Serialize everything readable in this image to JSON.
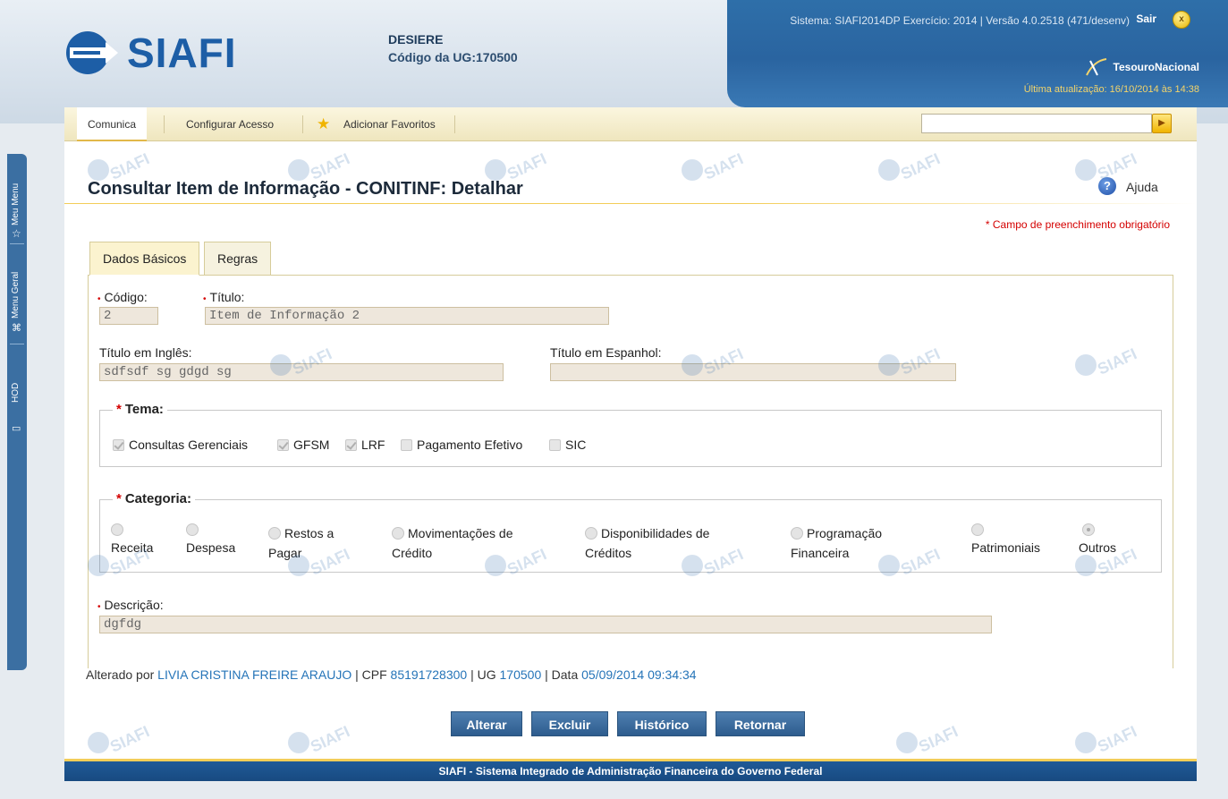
{
  "header": {
    "logo_text": "SIAFI",
    "user_name": "DESIERE",
    "ug_label": "Código da UG:",
    "ug_code": "170500",
    "system_line": "Sistema: SIAFI2014DP Exercício: 2014 | Versão 4.0.2518 (471/desenv)",
    "sair_label": "Sair",
    "tesouro_label": "TesouroNacional",
    "last_update": "Última atualização: 16/10/2014 às 14:38"
  },
  "side_tabs": {
    "meu_menu": "Meu Menu",
    "menu_geral": "Menu Geral",
    "hod": "HOD"
  },
  "menubar": {
    "comunica": "Comunica",
    "configurar": "Configurar Acesso",
    "favoritos": "Adicionar Favoritos",
    "search_placeholder": ""
  },
  "page": {
    "title": "Consultar Item de Informação - CONITINF: Detalhar",
    "ajuda": "Ajuda",
    "required_note": "* Campo de preenchimento obrigatório"
  },
  "tabs": [
    {
      "label": "Dados Básicos",
      "active": true
    },
    {
      "label": "Regras",
      "active": false
    }
  ],
  "form": {
    "codigo_label": "Código:",
    "codigo_value": "2",
    "titulo_label": "Título:",
    "titulo_value": "Item de Informação 2",
    "titulo_ingles_label": "Título em Inglês:",
    "titulo_ingles_value": "sdfsdf sg gdgd sg",
    "titulo_espanhol_label": "Título em Espanhol:",
    "titulo_espanhol_value": "",
    "tema_legend": "Tema:",
    "tema_options": [
      {
        "label": "Consultas Gerenciais",
        "checked": true
      },
      {
        "label": "GFSM",
        "checked": true
      },
      {
        "label": "LRF",
        "checked": true
      },
      {
        "label": "Pagamento Efetivo",
        "checked": false
      },
      {
        "label": "SIC",
        "checked": false
      }
    ],
    "categoria_legend": "Categoria:",
    "categoria_options": [
      {
        "line1": "",
        "line2": "Receita",
        "selected": false
      },
      {
        "line1": "",
        "line2": "Despesa",
        "selected": false
      },
      {
        "line1": "Restos a",
        "line2": "Pagar",
        "selected": false
      },
      {
        "line1": "Movimentações de",
        "line2": "Crédito",
        "selected": false
      },
      {
        "line1": "Disponibilidades de",
        "line2": "Créditos",
        "selected": false
      },
      {
        "line1": "Programação",
        "line2": "Financeira",
        "selected": false
      },
      {
        "line1": "",
        "line2": "Patrimoniais",
        "selected": false
      },
      {
        "line1": "",
        "line2": "Outros",
        "selected": true
      }
    ],
    "descricao_label": "Descrição:",
    "descricao_value": "dgfdg"
  },
  "meta": {
    "alterado_por_label": "Alterado por",
    "alterado_por": "LIVIA CRISTINA FREIRE ARAUJO",
    "cpf_label": "| CPF",
    "cpf": "85191728300",
    "ug_label": "| UG",
    "ug": "170500",
    "data_label": "| Data",
    "data": "05/09/2014 09:34:34"
  },
  "buttons": {
    "alterar": "Alterar",
    "excluir": "Excluir",
    "historico": "Histórico",
    "retornar": "Retornar"
  },
  "footer": {
    "text": "SIAFI - Sistema Integrado de Administração Financeira do Governo Federal"
  },
  "colors": {
    "brand_blue": "#1d5ea6",
    "accent_yellow": "#f3cd58",
    "required_red": "#d40000",
    "link_blue": "#2574b8"
  }
}
